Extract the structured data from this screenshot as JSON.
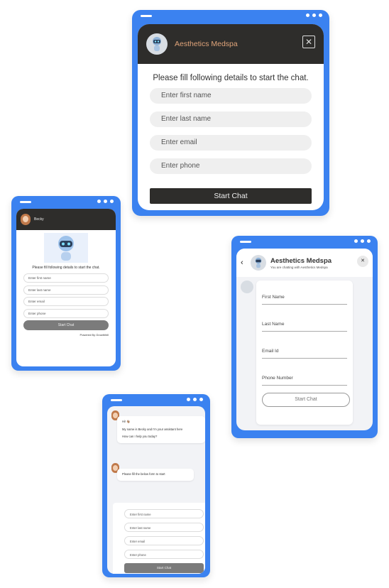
{
  "colors": {
    "frame_blue": "#3b82f0",
    "header_dark": "#2e2d2b",
    "title_accent": "#e0a47a",
    "button_gray": "#7b7b7b"
  },
  "card1": {
    "title": "Aesthetics Medspa",
    "close_label": "✕",
    "prompt": "Please fill following details to start the chat.",
    "fields": [
      "Enter first name",
      "Enter last name",
      "Enter email",
      "Enter phone"
    ],
    "button": "Start Chat"
  },
  "card2": {
    "agent_name": "Becky",
    "prompt": "Please fill following details to start the chat.",
    "fields": [
      "Enter first name",
      "Enter last name",
      "Enter email",
      "Enter phone"
    ],
    "button": "Start Chat",
    "powered": "Powered By Growthhill"
  },
  "card3": {
    "back_icon": "‹",
    "title": "Aesthetics Medspa",
    "subtitle": "You are chatting with Aesthetics Medspa",
    "close_label": "✕",
    "fields": [
      "First Name",
      "Last Name",
      "Email Id",
      "Phone Number"
    ],
    "button": "Start Chat"
  },
  "card4": {
    "greeting": "Hi! 👋🏽",
    "intro": "My name is Becky and I'm your assistant here",
    "question": "How can I help you today?",
    "form_prompt": "Please fill the below form to start",
    "fields": [
      "Enter first name",
      "Enter last name",
      "Enter email",
      "Enter phone"
    ],
    "button": "Start Chat"
  }
}
